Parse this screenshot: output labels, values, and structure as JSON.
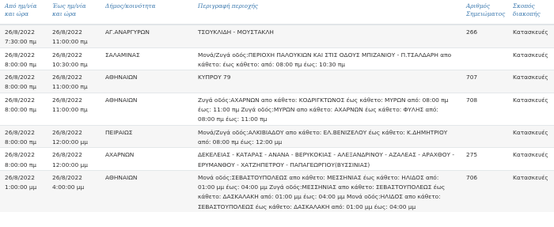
{
  "table": {
    "headers": [
      "Από ημ/νία και ώρα",
      "Έως ημ/νία και ώρα",
      "Δήμος/κοινότητα",
      "Περιγραφή περιοχής",
      "Αριθμός Σημειώματος",
      "Σκοπός διακοπής"
    ],
    "rows": [
      {
        "from": [
          "26/8/2022",
          "7:30:00 πμ"
        ],
        "to": [
          "26/8/2022",
          "11:00:00 πμ"
        ],
        "municipality": "ΑΓ.ΑΝΑΡΓΥΡΩΝ",
        "description": "ΤΣΟΥΚΛΙΔΗ - ΜΟΥΣΤΑΚΛΗ",
        "note_number": "266",
        "purpose": "Κατασκευές"
      },
      {
        "from": [
          "26/8/2022",
          "8:00:00 πμ"
        ],
        "to": [
          "26/8/2022",
          "10:30:00 πμ"
        ],
        "municipality": "ΣΑΛΑΜΙΝΑΣ",
        "description": "Μονά/Ζυγά οδός:ΠΕΡΙΟΧΗ ΠΑΛΟΥΚΙΩΝ ΚΑΙ ΣΤΙΣ ΟΔΟΥΣ ΜΠΙΖΑΝΙΟΥ - Π.ΤΣΑΛΔΑΡΗ απο κάθετο: έως κάθετο: από: 08:00 πμ έως: 10:30 πμ",
        "note_number": "",
        "purpose": "Κατασκευές"
      },
      {
        "from": [
          "26/8/2022",
          "8:00:00 πμ"
        ],
        "to": [
          "26/8/2022",
          "11:00:00 πμ"
        ],
        "municipality": "ΑΘΗΝΑΙΩΝ",
        "description": "ΚΥΠΡΟΥ 79",
        "note_number": "707",
        "purpose": "Κατασκευές"
      },
      {
        "from": [
          "26/8/2022",
          "8:00:00 πμ"
        ],
        "to": [
          "26/8/2022",
          "11:00:00 πμ"
        ],
        "municipality": "ΑΘΗΝΑΙΩΝ",
        "description": "Ζυγά οδός:ΑΧΑΡΝΩΝ απο κάθετο: ΚΟΔΡΙΓΚΤΩΝΟΣ έως κάθετο: ΜΥΡΩΝ από: 08:00 πμ έως: 11:00 πμ Ζυγά οδός:ΜΥΡΩΝ απο κάθετο: ΑΧΑΡΝΩΝ έως κάθετο: ΦΥΛΗΣ από: 08:00 πμ έως: 11:00 πμ",
        "note_number": "708",
        "purpose": "Κατασκευές"
      },
      {
        "from": [
          "26/8/2022",
          "8:00:00 πμ"
        ],
        "to": [
          "26/8/2022",
          "12:00:00 μμ"
        ],
        "municipality": "ΠΕΙΡΑΙΩΣ",
        "description": "Μονά/Ζυγά οδός:ΑΛΚΙΒΙΑΔΟΥ απο κάθετο: ΕΛ.ΒΕΝΙΖΕΛΟΥ έως κάθετο: Κ.ΔΗΜΗΤΡΙΟΥ από: 08:00 πμ έως: 12:00 μμ",
        "note_number": "",
        "purpose": "Κατασκευές"
      },
      {
        "from": [
          "26/8/2022",
          "8:00:00 πμ"
        ],
        "to": [
          "26/8/2022",
          "12:00:00 μμ"
        ],
        "municipality": "ΑΧΑΡΝΩΝ",
        "description": "ΔΕΚΕΛΕΙΑΣ - ΚΑΤΑΡΑΣ - ΑΝΑΝΑ - ΒΕΡΥΚΟΚΙΑΣ - ΑΛΕΞΑΝΔΡΙΝΟΥ - ΑΖΑΛΕΑΣ - ΑΡΑΧΘΟΥ - ΕΡΥΜΑΝΘΟΥ - ΧΑΤΖΗΠΕΤΡΟΥ - ΠΑΠΑΓΕΩΡΓΙΟΥ(ΒΥΣΣΙΝΙΑΣ)",
        "note_number": "275",
        "purpose": "Κατασκευές"
      },
      {
        "from": [
          "26/8/2022",
          "1:00:00 μμ"
        ],
        "to": [
          "26/8/2022",
          "4:00:00 μμ"
        ],
        "municipality": "ΑΘΗΝΑΙΩΝ",
        "description": "Μονά οδός:ΣΕΒΑΣΤΟΥΠΟΛΕΩΣ απο κάθετο: ΜΕΣΣΗΝΙΑΣ έως κάθετο: ΗΛΙΔΟΣ από: 01:00 μμ έως: 04:00 μμ Ζυγά οδός:ΜΕΣΣΗΝΙΑΣ απο κάθετο: ΣΕΒΑΣΤΟΥΠΟΛΕΩΣ έως κάθετο: ΔΑΣΚΑΛΑΚΗ από: 01:00 μμ έως: 04:00 μμ Μονά οδός:ΗΛΙΔΟΣ απο κάθετο: ΣΕΒΑΣΤΟΥΠΟΛΕΩΣ έως κάθετο: ΔΑΣΚΑΛΑΚΗ από: 01:00 μμ έως: 04:00 μμ",
        "note_number": "706",
        "purpose": "Κατασκευές"
      }
    ]
  }
}
